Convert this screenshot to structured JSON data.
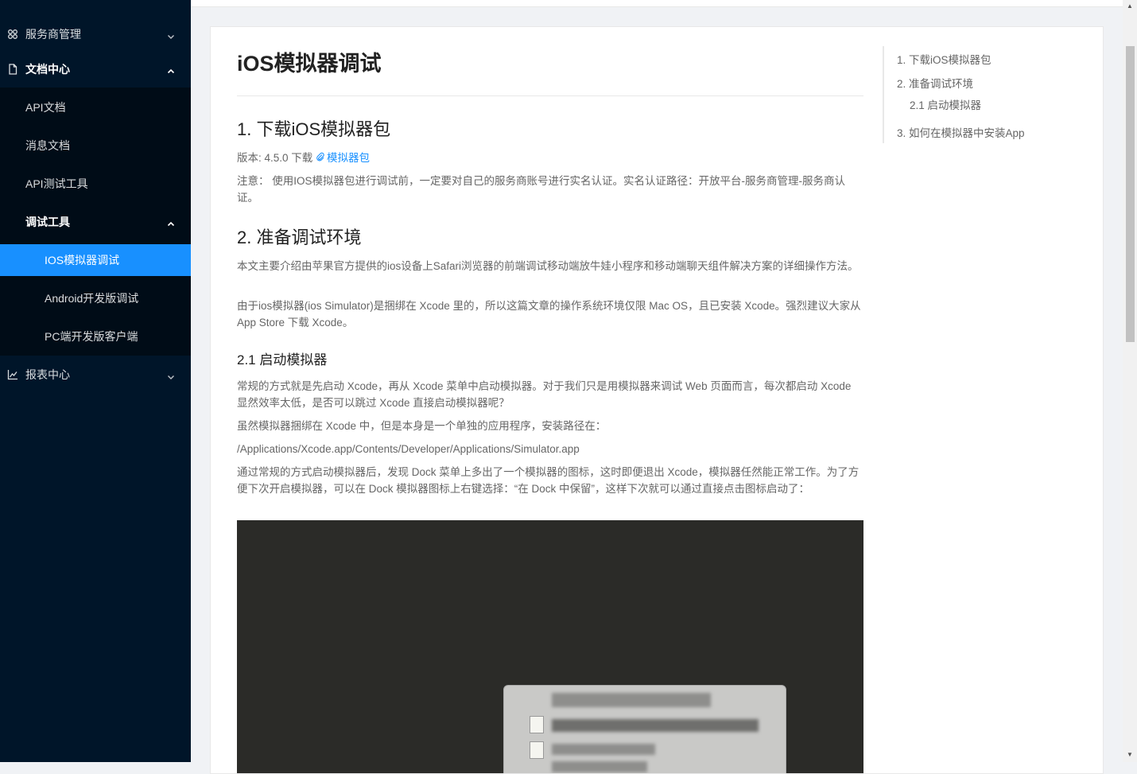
{
  "sidebar": {
    "items": [
      {
        "label": "服务商管理",
        "icon": "cluster-icon"
      },
      {
        "label": "文档中心",
        "icon": "file-icon"
      },
      {
        "label": "API文档"
      },
      {
        "label": "消息文档"
      },
      {
        "label": "API测试工具"
      },
      {
        "label": "调试工具"
      },
      {
        "label": "IOS模拟器调试"
      },
      {
        "label": "Android开发版调试"
      },
      {
        "label": "PC端开发版客户端"
      },
      {
        "label": "报表中心",
        "icon": "line-chart-icon"
      }
    ],
    "selected_color": "#1890ff"
  },
  "article": {
    "title": "iOS模拟器调试",
    "s1_title": "1. 下载iOS模拟器包",
    "s1_version": "版本: 4.5.0 下载",
    "s1_link": "模拟器包",
    "s1_note": "注意： 使用IOS模拟器包进行调试前，一定要对自己的服务商账号进行实名认证。实名认证路径：开放平台-服务商管理-服务商认证。",
    "s2_title": "2. 准备调试环境",
    "s2_p1": "本文主要介绍由苹果官方提供的ios设备上Safari浏览器的前端调试移动端放牛娃小程序和移动端聊天组件解决方案的详细操作方法。",
    "s2_p2": "由于ios模拟器(ios Simulator)是捆绑在 Xcode 里的，所以这篇文章的操作系统环境仅限 Mac OS，且已安装 Xcode。强烈建议大家从 App Store 下载 Xcode。",
    "s21_title": "2.1 启动模拟器",
    "s21_p1": "常规的方式就是先启动 Xcode，再从 Xcode 菜单中启动模拟器。对于我们只是用模拟器来调试 Web 页面而言，每次都启动 Xcode 显然效率太低，是否可以跳过 Xcode 直接启动模拟器呢？",
    "s21_p2": "虽然模拟器捆绑在 Xcode 中，但是本身是一个单独的应用程序，安装路径在：",
    "s21_path": "/Applications/Xcode.app/Contents/Developer/Applications/Simulator.app",
    "s21_p3": "通过常规的方式启动模拟器后，发现 Dock 菜单上多出了一个模拟器的图标，这时即便退出 Xcode，模拟器任然能正常工作。为了方便下次开启模拟器，可以在 Dock 模拟器图标上右键选择：“在 Dock 中保留”，这样下次就可以通过直接点击图标启动了："
  },
  "toc": {
    "items": [
      "1. 下载iOS模拟器包",
      "2. 准备调试环境",
      "2.1 启动模拟器",
      "3. 如何在模拟器中安装App"
    ]
  }
}
